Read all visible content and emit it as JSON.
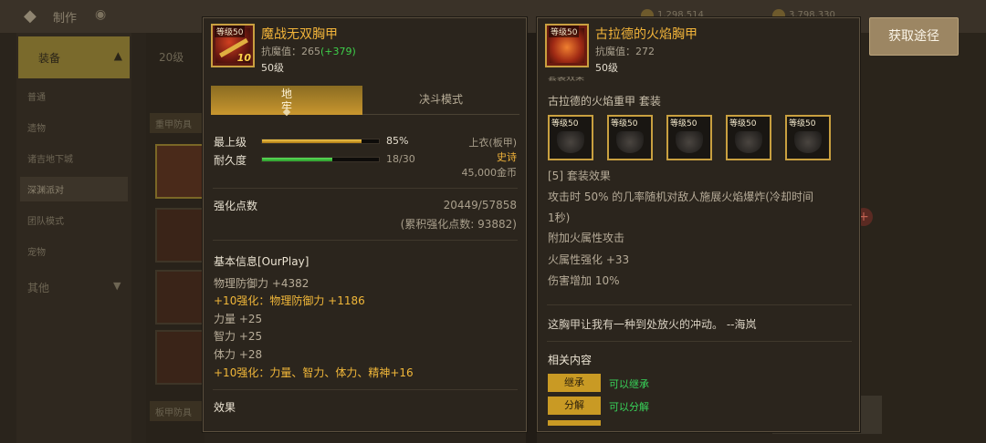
{
  "background": {
    "header_title": "制作",
    "gold_a": "1,298,514",
    "gold_b": "3,798,330",
    "sidebar_header": "装备",
    "sidebar_items": [
      "普通",
      "遗物",
      "诸吉地下城",
      "深渊派对",
      "团队模式",
      "宠物"
    ],
    "sidebar_other": "其他",
    "level_num": "20级",
    "bar_top": "重甲防具",
    "bar_bottom": "板甲防具"
  },
  "left_item": {
    "name": "魔战无双胸甲",
    "icon_level": "等级50",
    "icon_plus": "10",
    "stat_label": "抗魔值：",
    "stat_value": "265",
    "stat_bonus": "(+379)",
    "level": "50级",
    "tabs": [
      "地\n牢",
      "决斗模式"
    ],
    "grade_label": "最上级",
    "grade_percent": "85%",
    "grade_fill": 0.85,
    "durability_label": "耐久度",
    "durability_value": "18/30",
    "durability_fill": 0.6,
    "slot": "上衣(板甲)",
    "rarity": "史诗",
    "price": "45,000金币",
    "enhance_label": "强化点数",
    "enhance_value": "20449/57858",
    "enhance_total": "(累积强化点数: 93882)",
    "basic_title": "基本信息[OurPlay]",
    "basic_lines": [
      "物理防御力 +4382",
      "+10强化：物理防御力 +1186",
      "力量 +25",
      "智力 +25",
      "体力 +28",
      "+10强化：力量、智力、体力、精神+16"
    ],
    "effect_title": "效果"
  },
  "right_item": {
    "name": "古拉德的火焰胸甲",
    "icon_level": "等级50",
    "stat_label": "抗魔值：",
    "stat_value": "272",
    "level": "50级",
    "set_cut": "套装效果",
    "set_name": "古拉德的火焰重甲 套装",
    "pieces": [
      "等级50",
      "等级50",
      "等级50",
      "等级50",
      "等级50"
    ],
    "set_effect_title": "[5] 套装效果",
    "set_effect_lines": [
      "攻击时 50% 的几率随机对敌人施展火焰爆炸(冷却时间",
      "1秒)",
      "附加火属性攻击",
      "火属性强化 +33",
      "伤害增加 10%"
    ],
    "quote": "这胸甲让我有一种到处放火的冲动。 --海岚",
    "related_title": "相关内容",
    "actions": [
      {
        "label": "继承",
        "note": "可以继承"
      },
      {
        "label": "分解",
        "note": "可以分解"
      }
    ]
  },
  "get_button": "获取途径",
  "colors": {
    "gold": "#f2b43a",
    "green": "#3ecf4a",
    "panel_bg": "#2b251d",
    "button_gold": "#c99a24"
  },
  "icons": [
    "back-arrow-icon",
    "eye-icon",
    "chevron-up-icon",
    "chevron-down-icon",
    "coin-icon",
    "plus-icon"
  ]
}
